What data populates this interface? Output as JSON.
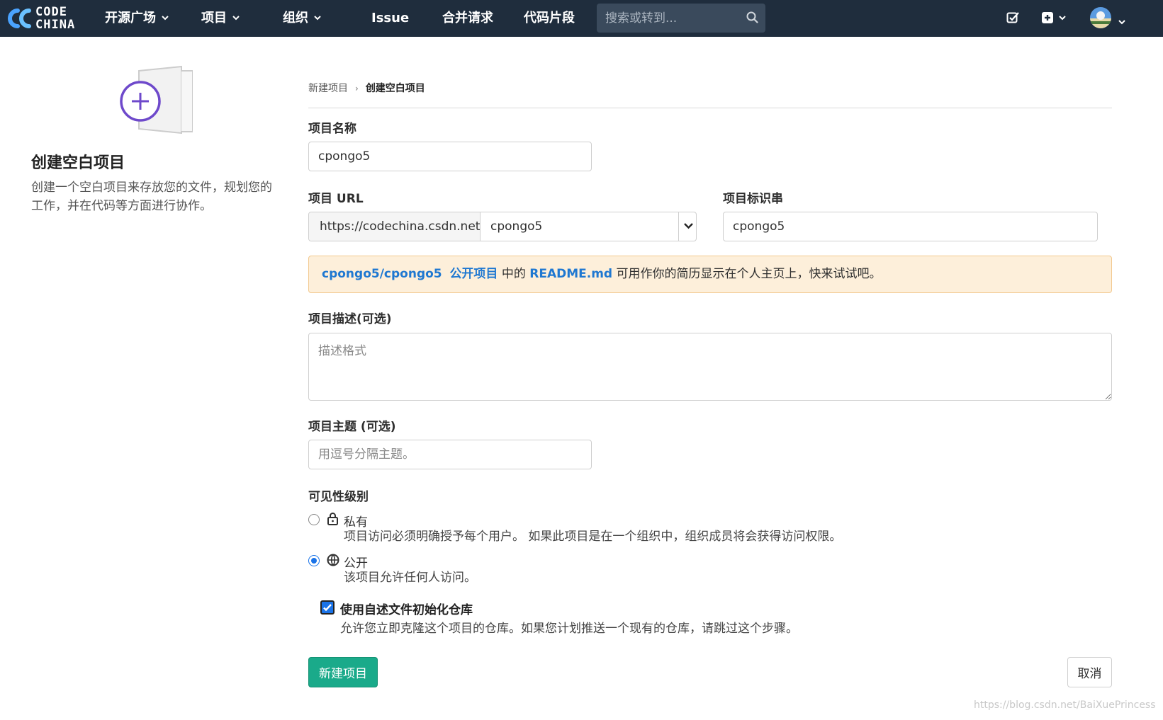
{
  "navbar": {
    "logo_line1": "CODE",
    "logo_line2": "CHINA",
    "items": [
      {
        "label": "开源广场",
        "has_dropdown": true
      },
      {
        "label": "项目",
        "has_dropdown": true
      },
      {
        "label": "组织",
        "has_dropdown": true
      },
      {
        "label": "Issue",
        "has_dropdown": false
      },
      {
        "label": "合并请求",
        "has_dropdown": false
      },
      {
        "label": "代码片段",
        "has_dropdown": false
      }
    ],
    "search_placeholder": "搜索或转到...",
    "icons": [
      "todo-icon",
      "plus-square-icon",
      "avatar"
    ]
  },
  "sidebar": {
    "title": "创建空白项目",
    "description": "创建一个空白项目来存放您的文件，规划您的工作，并在代码等方面进行协作。"
  },
  "breadcrumb": {
    "parent": "新建项目",
    "current": "创建空白项目"
  },
  "form": {
    "name_label": "项目名称",
    "name_value": "cpongo5",
    "url_label": "项目 URL",
    "url_prefix": "https://codechina.csdn.net/",
    "url_namespace": "cpongo5",
    "slug_label": "项目标识串",
    "slug_value": "cpongo5",
    "alert": {
      "path": "cpongo5/cpongo5",
      "visibility": "公开项目",
      "mid": "中的",
      "file": "README.md",
      "rest": "可用作你的简历显示在个人主页上，快来试试吧。"
    },
    "desc_label": "项目描述(可选)",
    "desc_placeholder": "描述格式",
    "topics_label": "项目主题 (可选)",
    "topics_placeholder": "用逗号分隔主题。",
    "visibility_label": "可见性级别",
    "visibility_options": [
      {
        "title": "私有",
        "desc": "项目访问必须明确授予每个用户。 如果此项目是在一个组织中，组织成员将会获得访问权限。",
        "selected": false,
        "icon": "lock-icon"
      },
      {
        "title": "公开",
        "desc": "该项目允许任何人访问。",
        "selected": true,
        "icon": "globe-icon"
      }
    ],
    "readme_title": "使用自述文件初始化仓库",
    "readme_desc": "允许您立即克隆这个项目的仓库。如果您计划推送一个现有的仓库，请跳过这个步骤。",
    "readme_checked": true,
    "submit_label": "新建项目",
    "cancel_label": "取消"
  },
  "watermark": "https://blog.csdn.net/BaiXuePrincess",
  "colors": {
    "navbar_bg": "#1f2d3d",
    "primary": "#1aaa8a",
    "link": "#1f78d1",
    "alert_bg": "#fdefda",
    "accent_purple": "#6e49cb"
  }
}
